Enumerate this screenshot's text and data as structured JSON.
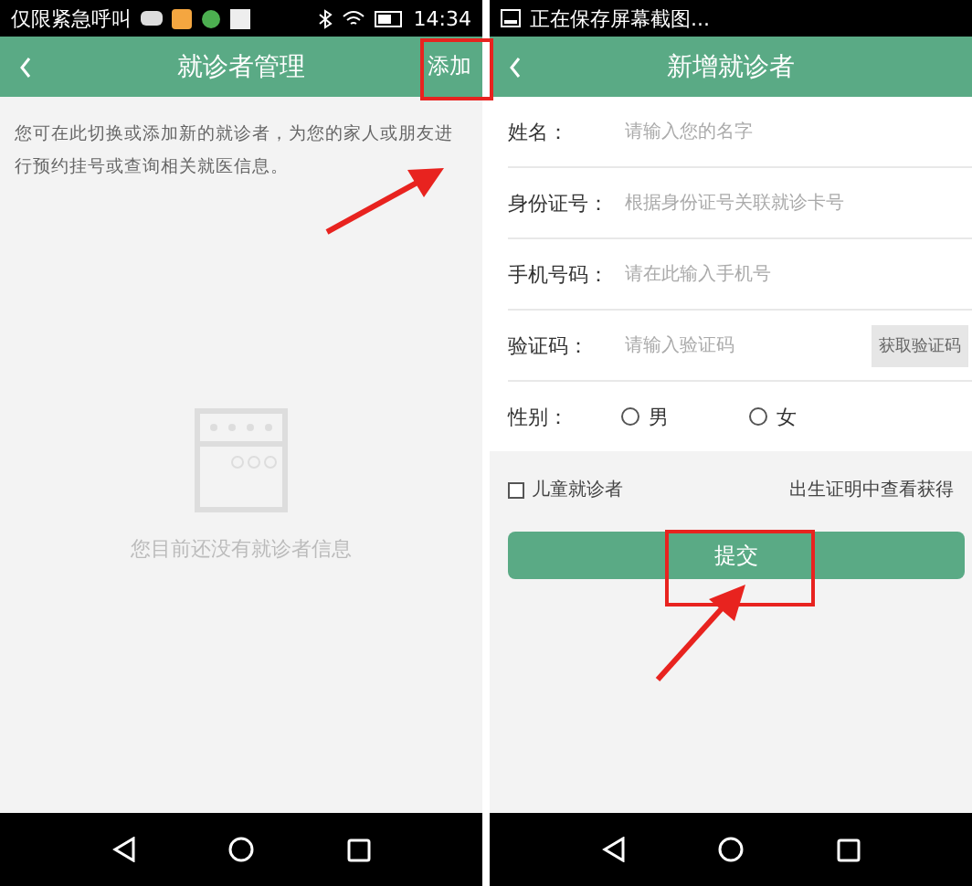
{
  "left_screen": {
    "status_bar": {
      "carrier": "仅限紧急呼叫",
      "time": "14:34"
    },
    "header": {
      "title": "就诊者管理",
      "action": "添加"
    },
    "intro": "您可在此切换或添加新的就诊者，为您的家人或朋友进行预约挂号或查询相关就医信息。",
    "empty_state": "您目前还没有就诊者信息"
  },
  "right_screen": {
    "status_bar": {
      "notice": "正在保存屏幕截图..."
    },
    "header": {
      "title": "新增就诊者"
    },
    "fields": [
      {
        "label": "姓名：",
        "placeholder": "请输入您的名字"
      },
      {
        "label": "身份证号：",
        "placeholder": "根据身份证号关联就诊卡号"
      },
      {
        "label": "手机号码：",
        "placeholder": "请在此输入手机号"
      },
      {
        "label": "验证码：",
        "placeholder": "请输入验证码",
        "button": "获取验证码"
      }
    ],
    "gender": {
      "label": "性别：",
      "options": [
        {
          "label": "男",
          "selected": false
        },
        {
          "label": "女",
          "selected": false
        }
      ]
    },
    "child_option": {
      "checked": false,
      "label": "儿童就诊者",
      "hint": "出生证明中查看获得"
    },
    "submit": "提交"
  }
}
